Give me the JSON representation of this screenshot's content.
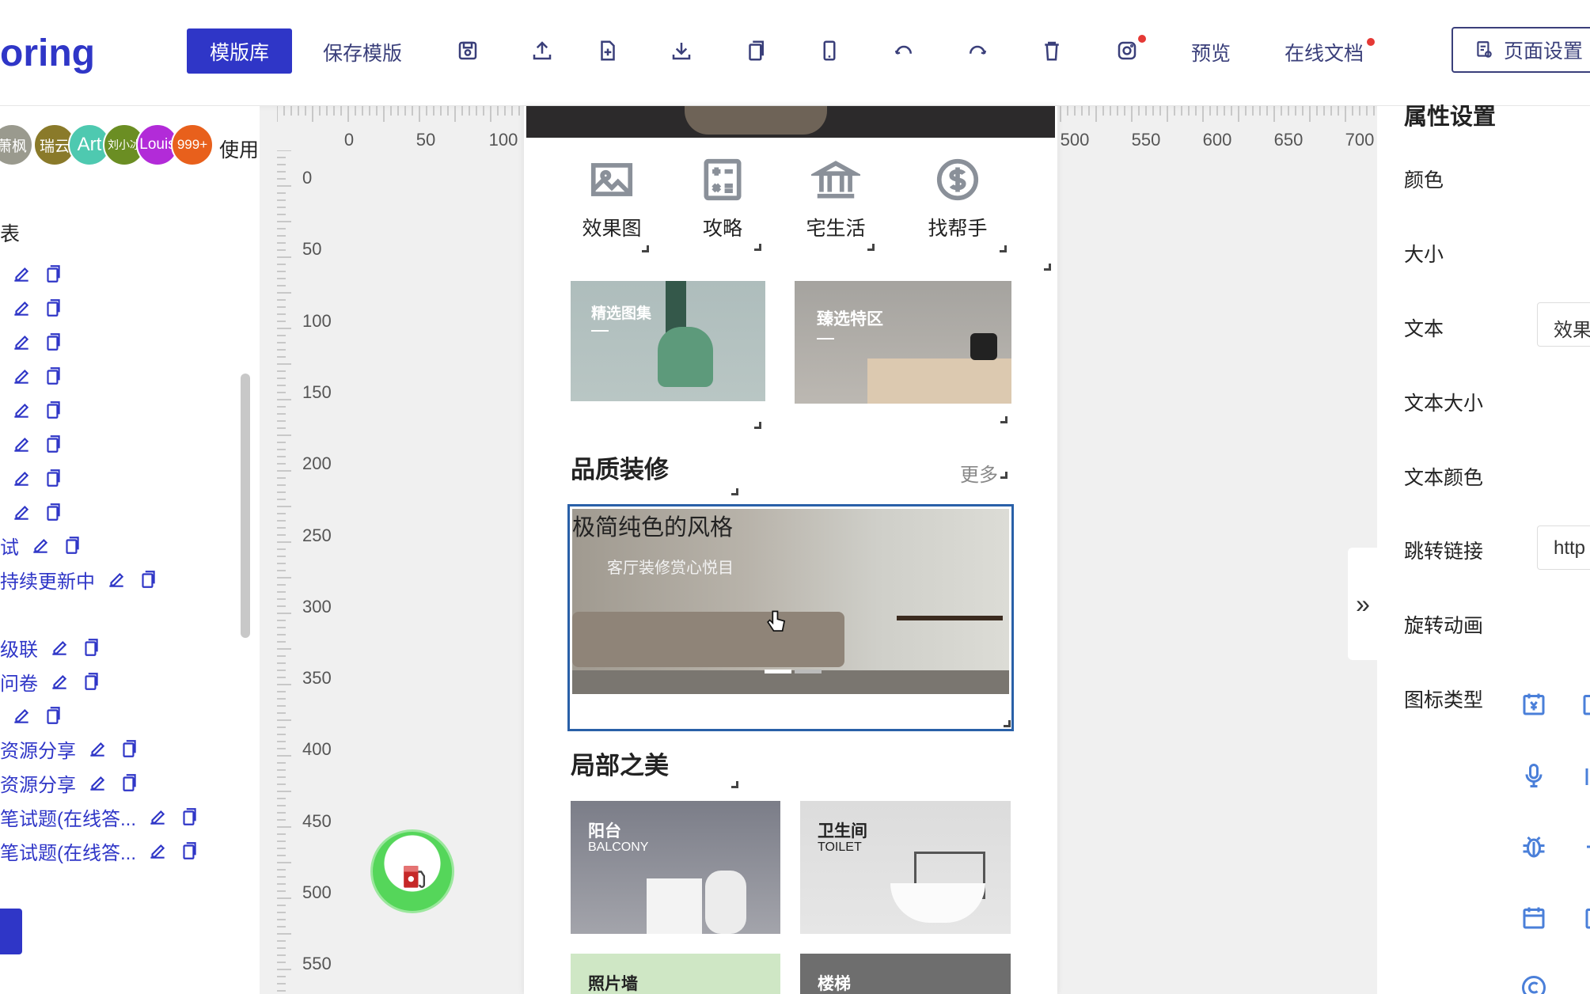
{
  "brand": "oring",
  "toolbar": {
    "templates_label": "模版库",
    "save_template_label": "保存模版",
    "icons": [
      "save-icon",
      "upload-icon",
      "new-file-icon",
      "download-icon",
      "copy-icon",
      "mobile-icon",
      "undo-icon",
      "redo-icon",
      "delete-icon",
      "instagram-icon"
    ],
    "preview_label": "预览",
    "docs_label": "在线文档",
    "page_settings_label": "页面设置"
  },
  "left_panel": {
    "avatars": [
      "萧枫",
      "瑞云",
      "Art",
      "刘小冰",
      "Louis",
      "999+"
    ],
    "use_label": "使用",
    "list_heading": "表",
    "items": [
      "",
      "",
      "",
      "",
      "",
      "",
      "",
      "",
      "试",
      "持续更新中",
      "",
      "级联",
      "问卷",
      "",
      "资源分享",
      "资源分享",
      "笔试题(在线答...",
      "笔试题(在线答..."
    ]
  },
  "ruler": {
    "top_labels": [
      "0",
      "50",
      "100",
      "500",
      "550",
      "600",
      "650",
      "700"
    ],
    "left_labels": [
      "0",
      "50",
      "100",
      "150",
      "200",
      "250",
      "300",
      "350",
      "400",
      "450",
      "500",
      "550"
    ]
  },
  "canvas": {
    "nav": [
      {
        "label": "效果图",
        "icon": "image-icon"
      },
      {
        "label": "攻略",
        "icon": "calculator-icon"
      },
      {
        "label": "宅生活",
        "icon": "bank-icon"
      },
      {
        "label": "找帮手",
        "icon": "dollar-icon"
      }
    ],
    "banners": [
      {
        "title": "精选图集"
      },
      {
        "title": "臻选特区"
      }
    ],
    "section1": {
      "title": "品质装修",
      "more": "更多"
    },
    "selected_banner": {
      "title": "极简纯色的风格",
      "subtitle": "客厅装修赏心悦目"
    },
    "section2": {
      "title": "局部之美"
    },
    "tiles": [
      {
        "cn": "阳台",
        "en": "BALCONY"
      },
      {
        "cn": "卫生间",
        "en": "TOILET"
      },
      {
        "cn": "照片墙",
        "en": ""
      },
      {
        "cn": "楼梯",
        "en": ""
      }
    ]
  },
  "right_panel": {
    "title": "属性设置",
    "labels": [
      "颜色",
      "大小",
      "文本",
      "文本大小",
      "文本颜色",
      "跳转链接",
      "旋转动画",
      "图标类型"
    ],
    "text_value": "效果",
    "link_value": "http",
    "collapse": "»",
    "icon_types": [
      "yen-calendar-icon",
      "microphone-icon",
      "bug-icon",
      "calendar-icon",
      "copyright-icon"
    ]
  },
  "colors": {
    "accent": "#2f36c7",
    "selection": "#2960a8",
    "icon_blue": "#4a7fd9"
  }
}
